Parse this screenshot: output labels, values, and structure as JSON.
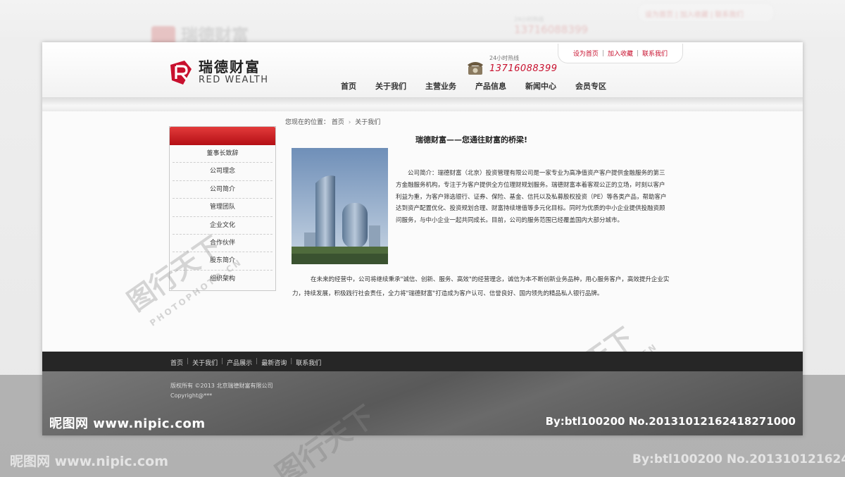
{
  "brand": {
    "name_cn": "瑞德财富",
    "name_en": "RED WEALTH",
    "logo_letter": "R",
    "accent_color": "#c8102e"
  },
  "hotline": {
    "label": "24小时热线",
    "number": "13716088399",
    "icon": "telephone-icon"
  },
  "top_links": [
    "设为首页",
    "加入收藏",
    "联系我们"
  ],
  "main_nav": [
    "首页",
    "关于我们",
    "主营业务",
    "产品信息",
    "新闻中心",
    "会员专区"
  ],
  "breadcrumb": {
    "prefix": "您现在的位置：",
    "items": [
      "首页",
      "关于我们"
    ]
  },
  "sidebar": {
    "items": [
      "董事长致辞",
      "公司理念",
      "公司简介",
      "管理团队",
      "企业文化",
      "合作伙伴",
      "股东简介",
      "组织架构"
    ]
  },
  "article": {
    "title": "瑞德财富——您通往财富的桥梁!",
    "paragraph1": "公司简介：瑞德财富（北京）投资管理有限公司是一家专业为高净值资产客户提供金融服务的第三方金融服务机构，专注于为客户提供全方位理财规划服务。瑞德财富本着客观公正的立场，时刻以客户利益为重，为客户筛选银行、证券、保险、基金、信托以及私募股权投资（PE）等各类产品，帮助客户达到资产配置优化、投资规划合理、财富持续增值等多元化目标。同时为优质的中小企业提供投融资顾问服务，与中小企业一起共同成长。目前，公司的服务范围已经覆盖国内大部分城市。",
    "paragraph2": "在未来的经营中，公司将继续秉承\"诚信、创新、服务、高效\"的经营理念，诚信为本不断创新业务品种，用心服务客户，高效提升企业实力，持续发展，积极践行社会责任，全力将\"瑞德财富\"打造成为客户认可、信誉良好、国内领先的精品私人银行品牌。"
  },
  "footer": {
    "links": [
      "首页",
      "关于我们",
      "产品展示",
      "最新咨询",
      "联系我们"
    ],
    "copyright": "版权所有 ©2013 北京瑞德财富有限公司",
    "copyright2": "Copyright@***"
  },
  "watermarks": {
    "nipic_left": "昵图网 www.nipic.com",
    "nipic_right": "By:btl100200 No.20131012162418271000",
    "outer_left": "昵图网 www.nipic.com",
    "outer_right": "By:btl100200  No.201310121624",
    "photophoto_cn": "图行天下",
    "photophoto_en": "PHOTOPHOTO.CN"
  },
  "ghost": {
    "logo": "瑞德财富",
    "hotline_label": "24小时热线",
    "phone": "13716088399",
    "links": "设为首页 | 加入收藏 | 联系我们"
  }
}
